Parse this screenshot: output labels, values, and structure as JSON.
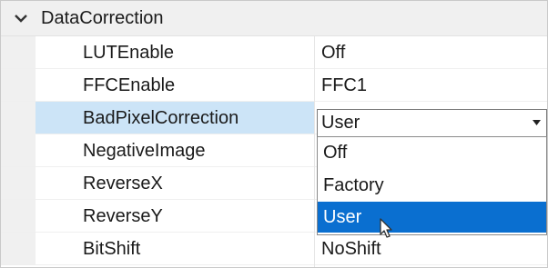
{
  "category": {
    "label": "DataCorrection",
    "icon": "chevron-down-icon",
    "expanded": true
  },
  "properties": [
    {
      "name": "LUTEnable",
      "value": "Off"
    },
    {
      "name": "FFCEnable",
      "value": "FFC1"
    },
    {
      "name": "BadPixelCorrection",
      "value": "User"
    },
    {
      "name": "NegativeImage",
      "value": ""
    },
    {
      "name": "ReverseX",
      "value": ""
    },
    {
      "name": "ReverseY",
      "value": ""
    },
    {
      "name": "BitShift",
      "value": "NoShift"
    }
  ],
  "combo": {
    "selected": "User",
    "options": [
      "Off",
      "Factory",
      "User"
    ],
    "highlighted_option": "User"
  },
  "colors": {
    "selection": "#cce4f7",
    "highlight": "#0a6fd0",
    "category_background": "#f0f0f0"
  }
}
